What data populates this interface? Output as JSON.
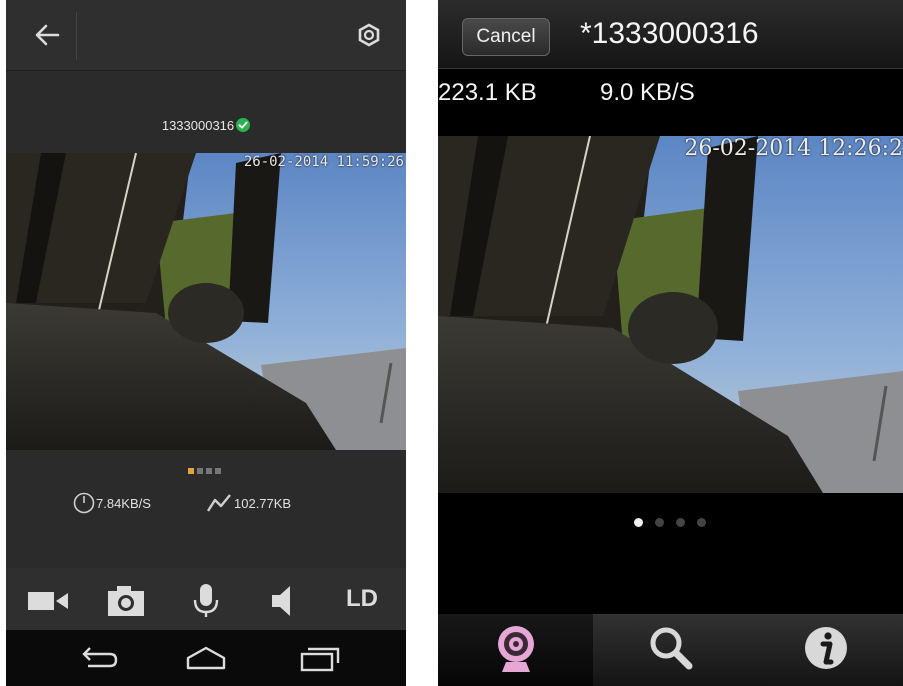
{
  "left_screen": {
    "header": {
      "back_icon": "arrow-left-icon",
      "settings_icon": "gear-icon"
    },
    "device": {
      "id": "1333000316",
      "status_icon": "check-circle-icon",
      "status_color": "#2bb24c"
    },
    "video": {
      "timestamp": "26-02-2014 11:59:26"
    },
    "pager": {
      "count": 4,
      "active": 0,
      "active_color": "#e8a23a"
    },
    "stats": {
      "speed_icon": "speedometer-icon",
      "speed": "7.84KB/S",
      "size_icon": "graph-icon",
      "size": "102.77KB"
    },
    "controls": {
      "video_icon": "video-camera-icon",
      "snapshot_icon": "camera-icon",
      "mic_icon": "microphone-icon",
      "speaker_icon": "speaker-icon",
      "quality_label": "LD"
    },
    "navbar": {
      "back_icon": "nav-back-icon",
      "home_icon": "nav-home-icon",
      "recent_icon": "nav-recent-icon"
    }
  },
  "right_screen": {
    "header": {
      "cancel_label": "Cancel",
      "title": "*1333000316"
    },
    "stats": {
      "size": "223.1 KB",
      "speed": "9.0 KB/S"
    },
    "video": {
      "timestamp": "26-02-2014 12:26:2"
    },
    "pager": {
      "count": 4,
      "active": 0
    },
    "tabbar": {
      "tabs": [
        {
          "icon": "webcam-icon",
          "active": true,
          "color": "#e6a6d6"
        },
        {
          "icon": "search-icon",
          "active": false
        },
        {
          "icon": "info-icon",
          "active": false
        }
      ]
    }
  }
}
